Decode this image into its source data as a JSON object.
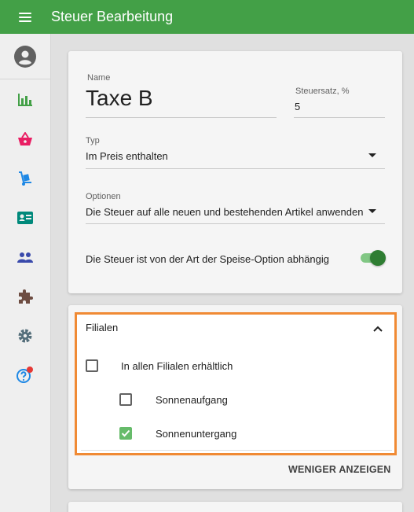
{
  "appbar": {
    "title": "Steuer Bearbeitung"
  },
  "sidebar": {
    "items": [
      {
        "icon": "avatar-icon"
      },
      {
        "icon": "bar-chart-icon",
        "color": "#43a047"
      },
      {
        "icon": "basket-icon",
        "color": "#e91e63"
      },
      {
        "icon": "hand-truck-icon",
        "color": "#1e88e5"
      },
      {
        "icon": "id-card-icon",
        "color": "#00897b"
      },
      {
        "icon": "people-icon",
        "color": "#3949ab"
      },
      {
        "icon": "puzzle-icon",
        "color": "#6d4c41"
      },
      {
        "icon": "gear-icon",
        "color": "#546e7a"
      },
      {
        "icon": "help-icon",
        "color": "#1e88e5",
        "badge_color": "#e53935"
      }
    ]
  },
  "form": {
    "name_label": "Name",
    "name_value": "Taxe B",
    "rate_label": "Steuersatz, %",
    "rate_value": "5",
    "type_label": "Typ",
    "type_value": "Im Preis enthalten",
    "options_label": "Optionen",
    "options_value": "Die Steuer auf alle neuen und bestehenden Artikel anwenden",
    "toggle_label": "Die Steuer ist von der Art der Speise-Option abhängig",
    "toggle_on": true
  },
  "branches": {
    "title": "Filialen",
    "all_label": "In allen Filialen erhältlich",
    "all_checked": false,
    "items": [
      {
        "label": "Sonnenaufgang",
        "checked": false
      },
      {
        "label": "Sonnenuntergang",
        "checked": true
      }
    ],
    "less_label": "WENIGER ANZEIGEN"
  },
  "colors": {
    "accent": "#43a047",
    "highlight": "#f08a34",
    "check": "#66bb6a"
  }
}
